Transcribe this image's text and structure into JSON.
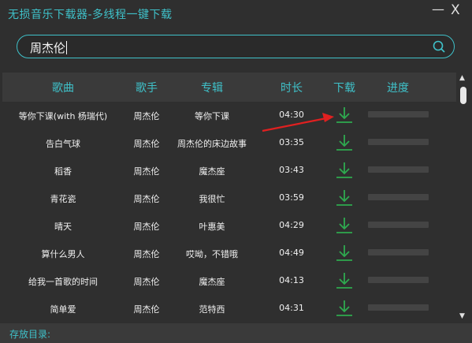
{
  "app": {
    "title": "无损音乐下载器-多线程一键下载"
  },
  "window": {
    "minimize_glyph": "—",
    "close_glyph": "X"
  },
  "search": {
    "value": "周杰伦",
    "icon": "search-icon"
  },
  "table": {
    "columns": [
      "歌曲",
      "歌手",
      "专辑",
      "时长",
      "下载",
      "进度"
    ],
    "rows": [
      {
        "song": "等你下课(with 杨瑞代)",
        "artist": "周杰伦",
        "album": "等你下课",
        "duration": "04:30",
        "progress": 0
      },
      {
        "song": "告白气球",
        "artist": "周杰伦",
        "album": "周杰伦的床边故事",
        "duration": "03:35",
        "progress": 0
      },
      {
        "song": "稻香",
        "artist": "周杰伦",
        "album": "魔杰座",
        "duration": "03:43",
        "progress": 0
      },
      {
        "song": "青花瓷",
        "artist": "周杰伦",
        "album": "我很忙",
        "duration": "03:59",
        "progress": 0
      },
      {
        "song": "晴天",
        "artist": "周杰伦",
        "album": "叶惠美",
        "duration": "04:29",
        "progress": 0
      },
      {
        "song": "算什么男人",
        "artist": "周杰伦",
        "album": "哎呦，不错哦",
        "duration": "04:49",
        "progress": 0
      },
      {
        "song": "给我一首歌的时间",
        "artist": "周杰伦",
        "album": "魔杰座",
        "duration": "04:13",
        "progress": 0
      },
      {
        "song": "简单爱",
        "artist": "周杰伦",
        "album": "范特西",
        "duration": "04:31",
        "progress": 0
      }
    ]
  },
  "footer": {
    "save_dir_label": "存放目录:"
  },
  "colors": {
    "accent": "#3fc1c9",
    "download_icon": "#2eaa4f",
    "annotation_arrow": "#e02020"
  },
  "icons": [
    "minimize-icon",
    "close-icon",
    "search-icon",
    "download-icon",
    "scroll-up-icon",
    "scroll-down-icon",
    "annotation-arrow-icon"
  ]
}
